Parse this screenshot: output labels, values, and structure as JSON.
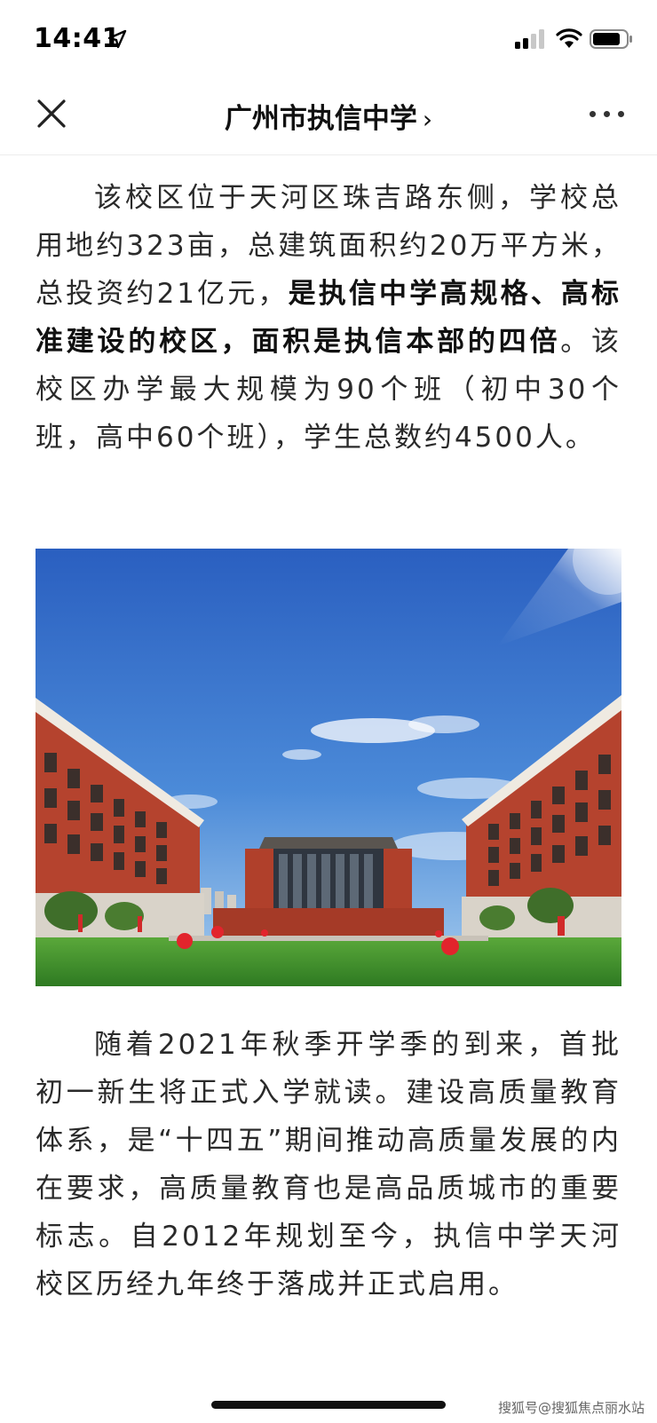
{
  "status": {
    "time": "14:41",
    "icons": [
      "location-arrow-icon",
      "cellular-signal-icon",
      "wifi-icon",
      "battery-icon"
    ]
  },
  "nav": {
    "title": "广州市执信中学",
    "chevron": "›",
    "close_icon": "close-icon",
    "more_icon": "more-dots-icon"
  },
  "article": {
    "para1": {
      "lead": "该校区位于天河区珠吉路东侧，学校总用地约323亩，总建筑面积约20万平方米，总投资约21亿元，",
      "bold": "是执信中学高规格、高标准建设的校区，面积是执信本部的四倍",
      "tail": "。该校区办学最大规模为90个班（初中30个班，高中60个班），学生总数约4500人。"
    },
    "photo_alt": "",
    "para2": "随着2021年秋季开学季的到来，首批初一新生将正式入学就读。建设高质量教育体系，是“十四五”期间推动高质量发展的内在要求，高质量教育也是高品质城市的重要标志。自2012年规划至今，执信中学天河校区历经九年终于落成并正式启用。"
  },
  "footer": {
    "watermark": "搜狐号@搜狐焦点丽水站"
  },
  "colors": {
    "sky_top": "#2d65c4",
    "sky_bottom": "#9cc7ec",
    "brick": "#b5432e",
    "grass": "#3f8c2c",
    "balloon": "#e2242c"
  }
}
